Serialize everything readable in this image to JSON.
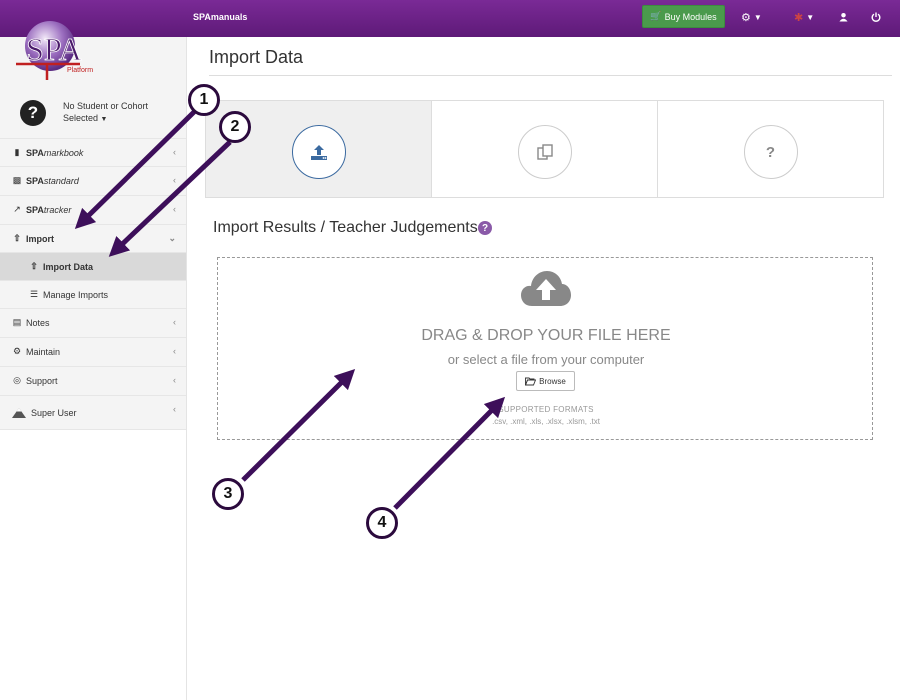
{
  "app": {
    "brand": "SPAmanuals",
    "logo_text": "SPA",
    "logo_sub": "Platform"
  },
  "topbar": {
    "buy_label": "Buy Modules",
    "icons": [
      "cart-icon",
      "cogs-icon",
      "puzzle-icon",
      "user-icon",
      "power-icon"
    ]
  },
  "student": {
    "line1": "No Student or Cohort",
    "line2": "Selected"
  },
  "sidebar": {
    "items": [
      {
        "prefix": "SPA",
        "suffix": "markbook"
      },
      {
        "prefix": "SPA",
        "suffix": "standard"
      },
      {
        "prefix": "SPA",
        "suffix": "tracker"
      },
      {
        "label": "Import"
      },
      {
        "label": "Import Data"
      },
      {
        "label": "Manage Imports"
      },
      {
        "label": "Notes"
      },
      {
        "label": "Maintain"
      },
      {
        "label": "Support"
      },
      {
        "label": "Super User"
      }
    ]
  },
  "page": {
    "title": "Import Data",
    "section_title": "Import Results / Teacher Judgements",
    "help": "?"
  },
  "tabs": [
    {
      "icon": "upload-icon",
      "active": true
    },
    {
      "icon": "copy-icon",
      "active": false
    },
    {
      "icon": "question-icon",
      "label": "?",
      "active": false
    }
  ],
  "dropzone": {
    "heading": "DRAG & DROP YOUR FILE HERE",
    "sub": "or select a file from your computer",
    "browse_label": "Browse",
    "formats_title": "SUPPORTED FORMATS",
    "formats": ".csv, .xml, .xls, .xlsx, .xlsm, .txt"
  },
  "callouts": [
    "1",
    "2",
    "3",
    "4"
  ],
  "colors": {
    "topbar": "#6b2287",
    "buy_button": "#4a9a4c",
    "annotation": "#3d0f5a",
    "active_tab_icon": "#3b6aa0"
  }
}
